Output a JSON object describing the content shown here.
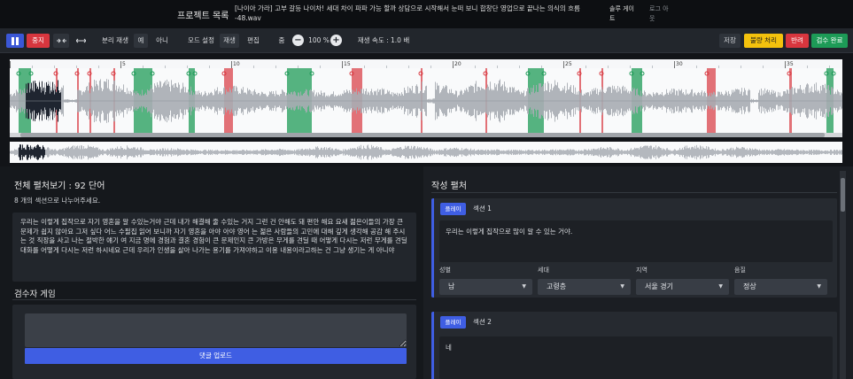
{
  "header": {
    "title": "프로젝트 목록",
    "filename": "[나이아 가라] 고부 갈등 나이차! 세대 차이 파파 가능 할까 상담으로 시작해서 눈떠 보니 합창단 영업으로 끝나는 의식의 흐름 -48.wav",
    "user": "솔루 게이 트",
    "logout": "로그 아 웃"
  },
  "toolbar": {
    "stop": "중지",
    "loop_label": "분리 재생",
    "yes": "예",
    "no": "아니",
    "mode_label": "모드 설정",
    "mode_play": "재생",
    "mode_edit": "편집",
    "zoom_label": "줌",
    "zoom_minus": "−",
    "zoom_value": "100 %",
    "zoom_plus": "+",
    "speed": "재생 속도 : 1.0 배",
    "save": "저장",
    "bulk": "불량 처리",
    "reject": "반려",
    "complete": "검수 완료"
  },
  "timeline": {
    "ticks": [
      "5",
      "10",
      "15",
      "20",
      "25",
      "30",
      "35"
    ]
  },
  "colors": {
    "accent": "#3f5ee3",
    "green_region": "#1d9b57",
    "red_region": "#d8363e",
    "yellow": "#f4c20d"
  },
  "left": {
    "heading": "전체 펼처보기 : 92 단어",
    "sub": "8 개의 섹션으로 나누어주세요.",
    "transcript": "우리는 이렇게 집작으로 자기 영혼을 알 수있는거야 근데 내가 해결해 줄 수있는 거지 그런 건 안해도 돼 편안 해요 요새 젊은이들의 가장 큰 문제가 쉽지 않아요 그저 싶다 어느 수필집 읽어 보니까 자기 영혼을 아야 아야 영어 는 젊은 사람들의 고민에 대해 깊게 생각해 공감 해 주시는 것 직장을 사고 나는 절박한 얘기 여 지금 명에 경험과 결혼 경험이 큰 문제인지 큰 가방은 무게를 견딜 때 어떻게 다시는 저런 무게를 견딜 대화를 어떻게 다시는 저런 하시네요 근데 우리가 인생을 살아 나가는 용기를 가져야하고 이용 내용이라고하는 건 그냥 생기는 게 아니야",
    "reviewer_heading": "검수자 게임",
    "comment_button": "댓글 업로드"
  },
  "right": {
    "heading": "작성 펼처",
    "play_label": "플레이",
    "sections": [
      {
        "name": "섹션 1",
        "text": "우리는 이렇게 집작으로 많이 알 수 있는 거야.",
        "fields": [
          {
            "label": "성별",
            "value": "남"
          },
          {
            "label": "세대",
            "value": "고령층"
          },
          {
            "label": "지역",
            "value": "서울 경기"
          },
          {
            "label": "음질",
            "value": "정상"
          }
        ]
      },
      {
        "name": "섹션 2",
        "text": "네"
      }
    ]
  }
}
